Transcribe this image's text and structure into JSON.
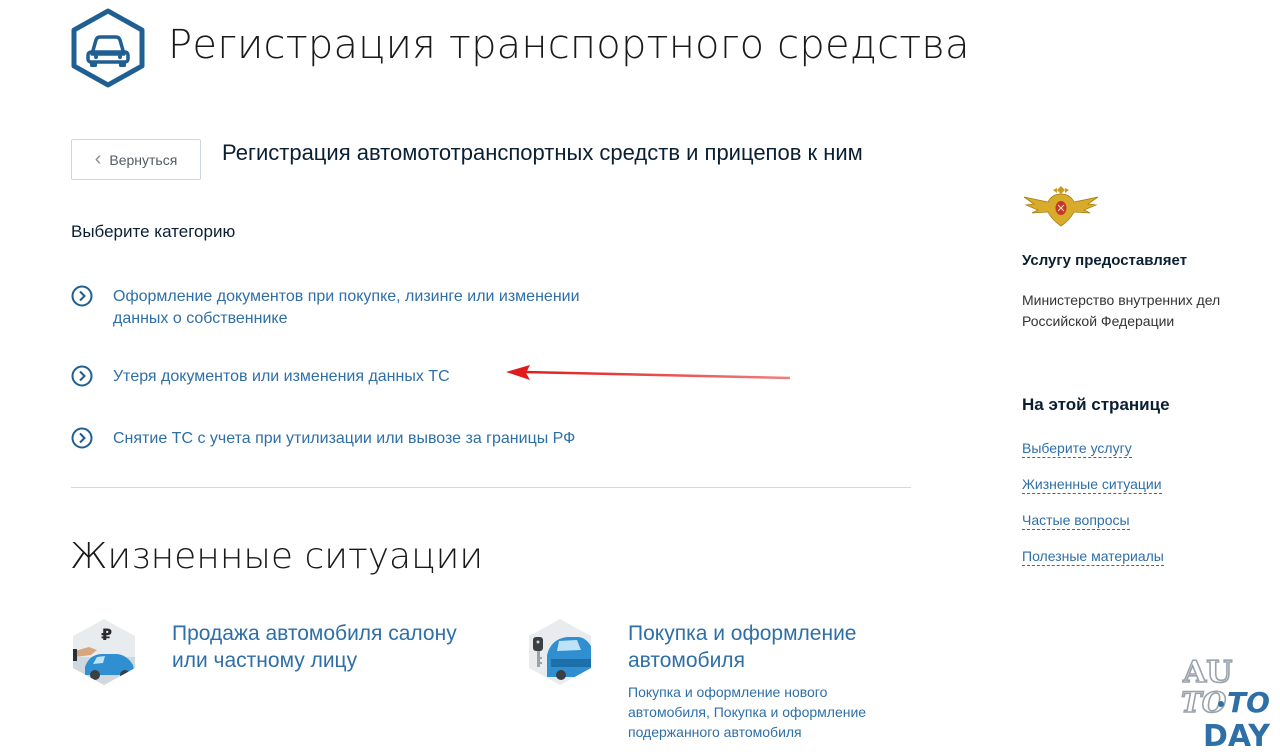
{
  "header": {
    "title": "Регистрация транспортного средства"
  },
  "back_button": {
    "label": "Вернуться"
  },
  "section_title": "Регистрация автомототранспортных средств и прицепов к ним",
  "categories": {
    "heading": "Выберите категорию",
    "items": [
      {
        "label": "Оформление документов при покупке, лизинге или изменении данных о собственнике"
      },
      {
        "label": "Утеря документов или изменения данных ТС"
      },
      {
        "label": "Снятие ТС с учета при утилизации или вывозе за границы РФ"
      }
    ]
  },
  "life_situations": {
    "heading": "Жизненные ситуации",
    "cards": [
      {
        "title": "Продажа автомобиля салону или частному лицу",
        "description": "",
        "icon": "car-sale-icon"
      },
      {
        "title": "Покупка и оформление автомобиля",
        "description": "Покупка и оформление нового автомобиля, Покупка и оформление подержанного автомобиля",
        "icon": "car-key-icon"
      }
    ]
  },
  "provider": {
    "heading": "Услугу предоставляет",
    "name": "Министерство внутренних дел Российской Федерации",
    "emblem_icon": "mvd-eagle-emblem-icon"
  },
  "on_this_page": {
    "heading": "На этой странице",
    "links": [
      "Выберите услугу",
      "Жизненные ситуации",
      "Частые вопросы",
      "Полезные материалы"
    ]
  },
  "watermark": {
    "line1": "AU",
    "line2a": "TO",
    "line2b": "TO",
    "line3": "DAY"
  },
  "colors": {
    "link": "#2f6fa8",
    "accent": "#1f5f92",
    "annotation_arrow": "#e01b1b"
  }
}
